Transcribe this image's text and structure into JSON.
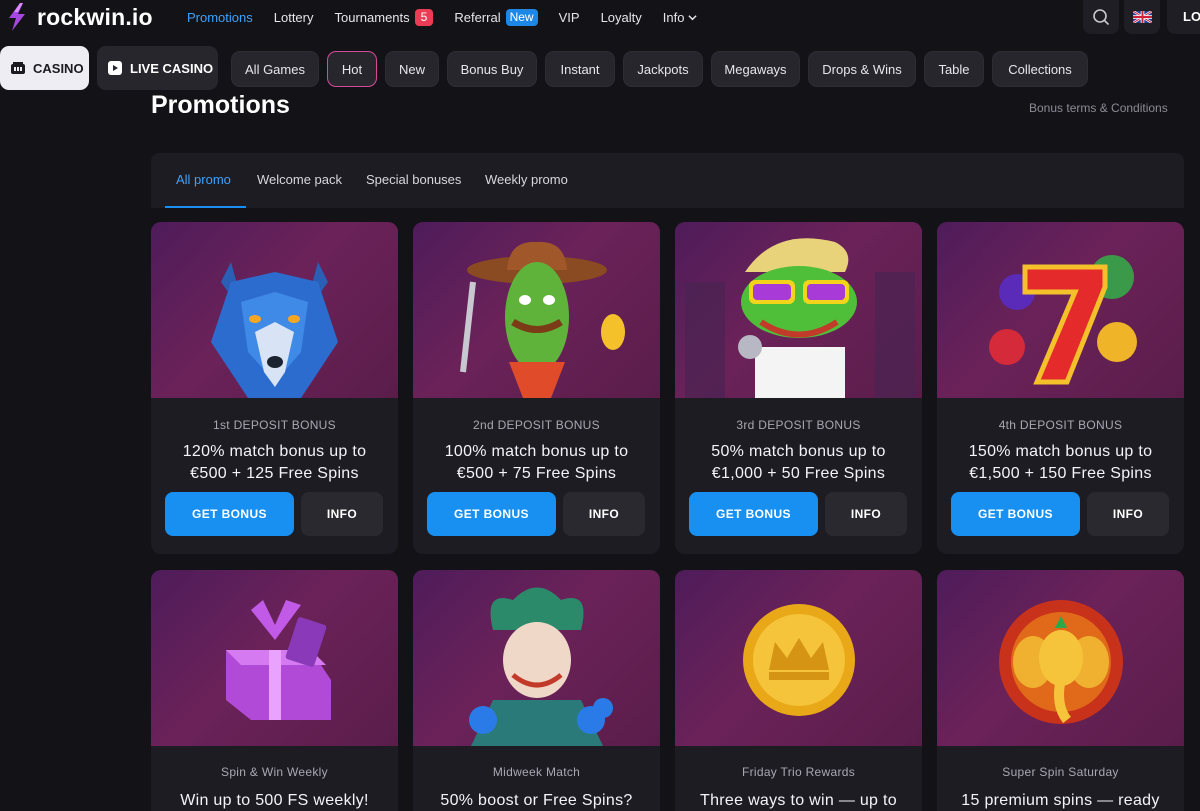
{
  "logo": {
    "text": "rockwin.io"
  },
  "nav": {
    "items": [
      {
        "label": "Promotions"
      },
      {
        "label": "Lottery"
      },
      {
        "label": "Tournaments",
        "badge": "5"
      },
      {
        "label": "Referral",
        "badge": "New"
      },
      {
        "label": "VIP"
      },
      {
        "label": "Loyalty"
      },
      {
        "label": "Info"
      }
    ],
    "login_label": "LO"
  },
  "modes": {
    "casino": "CASINO",
    "live_casino": "LIVE CASINO"
  },
  "categories": [
    "All Games",
    "Hot",
    "New",
    "Bonus Buy",
    "Instant",
    "Jackpots",
    "Megaways",
    "Drops & Wins",
    "Table",
    "Collections"
  ],
  "page": {
    "title": "Promotions",
    "terms_link": "Bonus terms & Conditions"
  },
  "tabs": [
    "All promo",
    "Welcome pack",
    "Special bonuses",
    "Weekly promo"
  ],
  "buttons": {
    "get_bonus": "GET BONUS",
    "info": "INFO"
  },
  "promos": [
    {
      "label": "1st DEPOSIT BONUS",
      "line1": "120% match bonus up to",
      "line2": "€500 + 125 Free Spins",
      "icon": "wolf-icon"
    },
    {
      "label": "2nd DEPOSIT BONUS",
      "line1": "100% match bonus up to",
      "line2": "€500 + 75 Free Spins",
      "icon": "cactus-cowboy-icon"
    },
    {
      "label": "3rd DEPOSIT BONUS",
      "line1": "50% match bonus up to",
      "line2": "€1,000 + 50 Free Spins",
      "icon": "frog-singer-icon"
    },
    {
      "label": "4th DEPOSIT BONUS",
      "line1": "150% match bonus up to",
      "line2": "€1,500 + 150 Free Spins",
      "icon": "lucky-seven-icon"
    },
    {
      "label": "Spin & Win Weekly",
      "line1": "Win up to 500 FS weekly!",
      "icon": "gift-box-icon"
    },
    {
      "label": "Midweek Match",
      "line1": "50% boost or Free Spins?",
      "icon": "jester-icon"
    },
    {
      "label": "Friday Trio Rewards",
      "line1": "Three ways to win — up to",
      "icon": "gold-coin-icon"
    },
    {
      "label": "Super Spin Saturday",
      "line1": "15 premium spins — ready",
      "icon": "golden-elephant-icon"
    }
  ],
  "colors": {
    "accent": "#1790f2",
    "background": "#131217",
    "card": "#1d1c23",
    "badge_red": "#ec3c55",
    "badge_blue": "#1d87e6"
  }
}
